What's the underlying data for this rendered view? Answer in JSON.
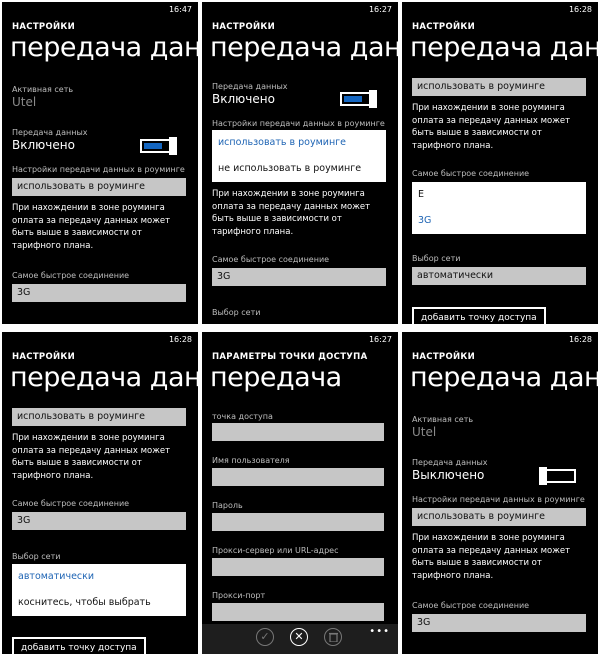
{
  "p1": {
    "time": "16:47",
    "app_title": "НАСТРОЙКИ",
    "page_title": "передача данн",
    "active_net_label": "Активная сеть",
    "active_net_value": "Utel",
    "data_label": "Передача данных",
    "data_value": "Включено",
    "roaming_label": "Настройки передачи данных в роуминге",
    "roaming_value": "использовать в роуминге",
    "roaming_desc": "При нахождении в зоне роуминга оплата за передачу данных может быть выше в зависимости от тарифного плана.",
    "fast_label": "Самое быстрое соединение",
    "fast_value": "3G"
  },
  "p2": {
    "time": "16:27",
    "app_title": "НАСТРОЙКИ",
    "page_title": "передача данн",
    "data_label": "Передача данных",
    "data_value": "Включено",
    "roaming_label": "Настройки передачи данных в роуминге",
    "opt_use": "использовать в роуминге",
    "opt_not_use": "не использовать в роуминге",
    "roaming_desc": "При нахождении в зоне роуминга оплата за передачу данных может быть выше в зависимости от тарифного плана.",
    "fast_label": "Самое быстрое соединение",
    "fast_value": "3G",
    "network_label": "Выбор сети"
  },
  "p3": {
    "time": "16:28",
    "app_title": "НАСТРОЙКИ",
    "page_title": "передача данн",
    "roaming_value": "использовать в роуминге",
    "roaming_desc": "При нахождении в зоне роуминга оплата за передачу данных может быть выше в зависимости от тарифного плана.",
    "fast_label": "Самое быстрое соединение",
    "opt_e": "E",
    "opt_3g": "3G",
    "network_label": "Выбор сети",
    "network_value": "автоматически",
    "add_ap_label": "добавить точку доступа"
  },
  "p4": {
    "time": "16:28",
    "app_title": "НАСТРОЙКИ",
    "page_title": "передача данн",
    "roaming_value": "использовать в роуминге",
    "roaming_desc": "При нахождении в зоне роуминга оплата за передачу данных может быть выше в зависимости от тарифного плана.",
    "fast_label": "Самое быстрое соединение",
    "fast_value": "3G",
    "network_label": "Выбор сети",
    "opt_auto": "автоматически",
    "opt_touch": "коснитесь, чтобы выбрать",
    "add_ap_label": "добавить точку доступа"
  },
  "p5": {
    "time": "16:27",
    "app_title": "ПАРАМЕТРЫ ТОЧКИ ДОСТУПА",
    "page_title": "передача",
    "ap_label": "точка доступа",
    "user_label": "Имя пользователя",
    "pass_label": "Пароль",
    "proxy_label": "Прокси-сервер или URL-адрес",
    "port_label": "Прокси-порт",
    "more": "•••"
  },
  "p6": {
    "time": "16:28",
    "app_title": "НАСТРОЙКИ",
    "page_title": "передача данн",
    "active_net_label": "Активная сеть",
    "active_net_value": "Utel",
    "data_label": "Передача данных",
    "data_value": "Выключено",
    "roaming_label": "Настройки передачи данных в роуминге",
    "roaming_value": "использовать в роуминге",
    "roaming_desc": "При нахождении в зоне роуминга оплата за передачу данных может быть выше в зависимости от тарифного плана.",
    "fast_label": "Самое быстрое соединение",
    "fast_value": "3G"
  },
  "colors": {
    "accent": "#1566c0",
    "field": "#c6c6c6",
    "background": "#000000"
  },
  "icons": {
    "save": "check-icon",
    "cancel": "close-icon",
    "delete": "trash-icon"
  }
}
